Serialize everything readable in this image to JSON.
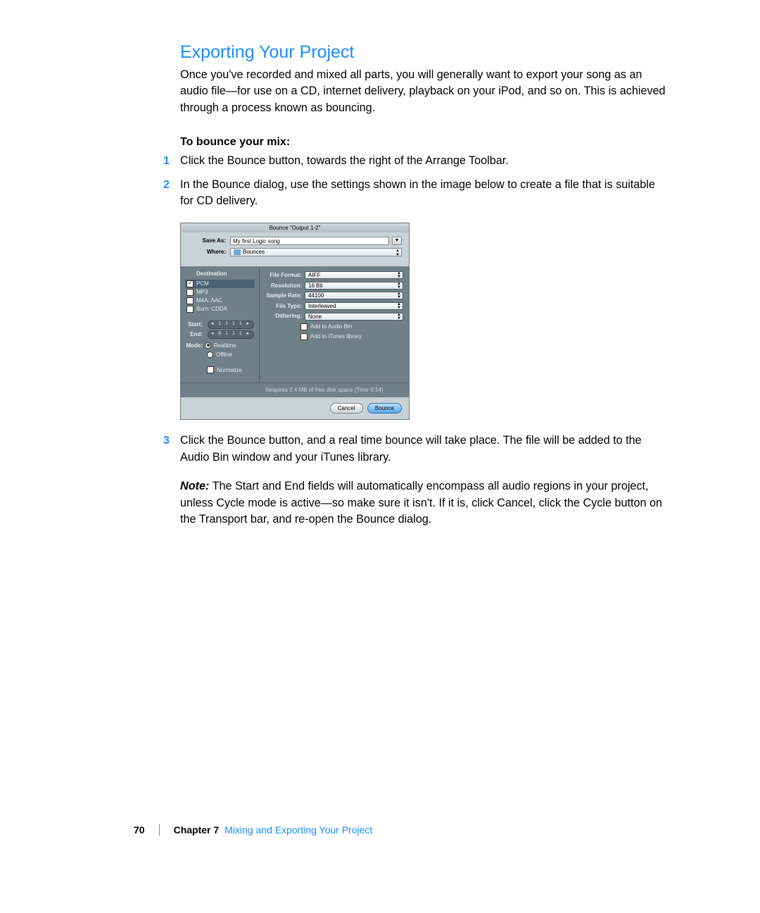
{
  "heading": "Exporting Your Project",
  "intro": "Once you've recorded and mixed all parts, you will generally want to export your song as an audio file—for use on a CD, internet delivery, playback on your iPod, and so on. This is achieved through a process known as bouncing.",
  "subhead": "To bounce your mix:",
  "steps": {
    "s1": "Click the Bounce button, towards the right of the Arrange Toolbar.",
    "s2": "In the Bounce dialog, use the settings shown in the image below to create a file that is suitable for CD delivery.",
    "s3": "Click the Bounce button, and a real time bounce will take place. The file will be added to the Audio Bin window and your iTunes library."
  },
  "note_label": "Note:",
  "note_text": "  The Start and End fields will automatically encompass all audio regions in your project, unless Cycle mode is active—so make sure it isn't. If it is, click Cancel, click the Cycle button on the Transport bar, and re-open the Bounce dialog.",
  "dialog": {
    "title": "Bounce \"Output 1-2\"",
    "save_as_label": "Save As:",
    "save_as_value": "My first Logic song",
    "where_label": "Where:",
    "where_value": "Bounces",
    "destination_header": "Destination",
    "destinations": {
      "d0": "PCM",
      "d1": "MP3",
      "d2": "M4A: AAC",
      "d3": "Burn: CDDA"
    },
    "start_label": "Start:",
    "start_value": "1  1  1   1",
    "end_label": "End:",
    "end_value": "8  1  1   1",
    "mode_label": "Mode:",
    "mode_realtime": "Realtime",
    "mode_offline": "Offline",
    "normalize": "Normalize",
    "rows": {
      "file_format_label": "File Format:",
      "file_format_value": "AIFF",
      "resolution_label": "Resolution:",
      "resolution_value": "16 Bit",
      "sample_rate_label": "Sample Rate:",
      "sample_rate_value": "44100",
      "file_type_label": "File Type:",
      "file_type_value": "Interleaved",
      "dithering_label": "Dithering:",
      "dithering_value": "None"
    },
    "add_audio_bin": "Add to Audio Bin",
    "add_itunes": "Add to iTunes library",
    "disk_space": "Requires 2,4 MB of free disk space  (Time 0:14)",
    "cancel": "Cancel",
    "bounce": "Bounce"
  },
  "footer": {
    "page": "70",
    "chapter": "Chapter 7",
    "title": "Mixing and Exporting Your Project"
  }
}
